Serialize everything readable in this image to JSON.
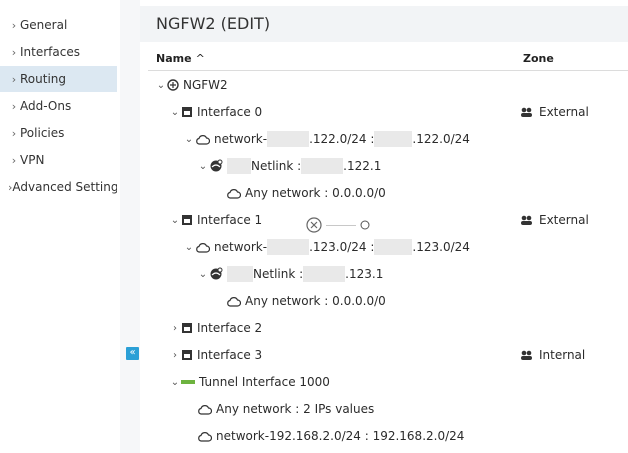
{
  "sidebar": {
    "items": [
      {
        "label": "General"
      },
      {
        "label": "Interfaces"
      },
      {
        "label": "Routing"
      },
      {
        "label": "Add-Ons"
      },
      {
        "label": "Policies"
      },
      {
        "label": "VPN"
      },
      {
        "label": "Advanced Setting"
      }
    ],
    "active": "Routing"
  },
  "header": {
    "title": "NGFW2 (EDIT)"
  },
  "table": {
    "col_name": "Name",
    "col_zone": "Zone",
    "sort_indicator": "^"
  },
  "tree": {
    "root": "NGFW2",
    "if0": {
      "label": "Interface 0",
      "zone": "External"
    },
    "if0_net": {
      "prefix": "network-",
      "mid": ".122.0/24 : ",
      "end": ".122.0/24"
    },
    "if0_netlink": {
      "label": "Netlink : ",
      "end": ".122.1"
    },
    "if0_any": "Any network : 0.0.0.0/0",
    "if1": {
      "label": "Interface 1",
      "zone": "External"
    },
    "if1_net": {
      "prefix": "network-",
      "mid": ".123.0/24 : ",
      "end": ".123.0/24"
    },
    "if1_netlink": {
      "label": "Netlink : ",
      "end": ".123.1"
    },
    "if1_any": "Any network : 0.0.0.0/0",
    "if2": {
      "label": "Interface 2"
    },
    "if3": {
      "label": "Interface 3",
      "zone": "Internal"
    },
    "tunnel": {
      "label": "Tunnel Interface 1000"
    },
    "tunnel_any": "Any network : 2 IPs values",
    "tunnel_net": "network-192.168.2.0/24 : 192.168.2.0/24"
  },
  "colors": {
    "accent": "#2a9fd6",
    "active_bg": "#dce8f2",
    "tunnel_green": "#6db33f"
  },
  "icons": {
    "collapse": "double-chevron-left-icon"
  }
}
